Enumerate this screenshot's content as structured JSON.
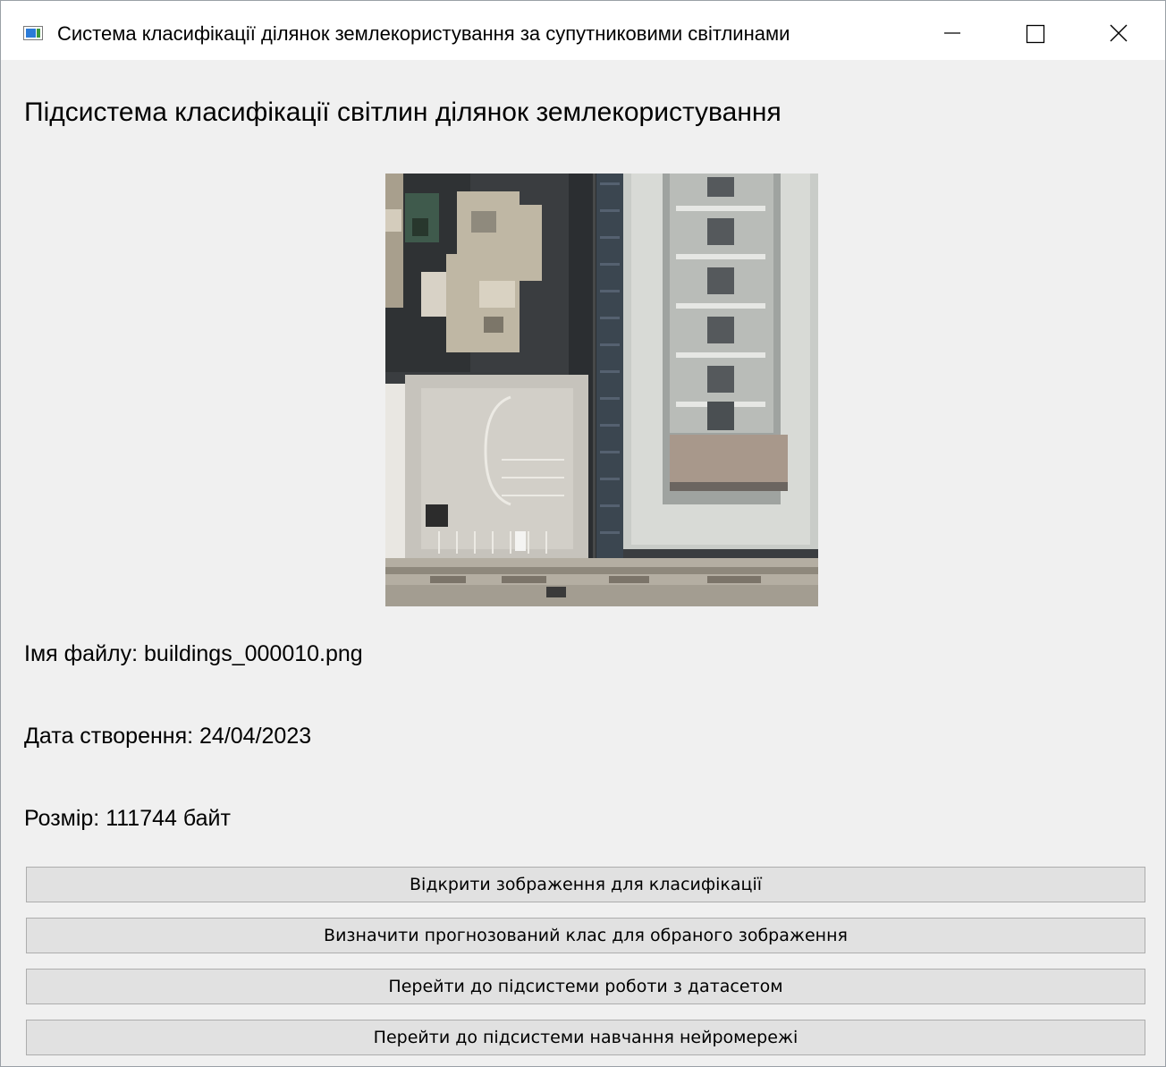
{
  "window": {
    "title": "Система класифікації ділянок землекористування за супутниковими світлинами",
    "controls": [
      "minimize-icon",
      "maximize-icon",
      "close-icon"
    ]
  },
  "main": {
    "heading": "Підсистема класифікації світлин ділянок землекористування",
    "image_alt": "buildings_000010.png",
    "file_name": "Імя файлу: buildings_000010.png",
    "created_date": "Дата створення: 24/04/2023",
    "file_size": "Розмір: 111744 байт"
  },
  "buttons": {
    "open_image": "Відкрити зображення для класифікації",
    "predict_class": "Визначити прогнозований клас для обраного зображення",
    "goto_dataset": "Перейти до підсистеми роботи з датасетом",
    "goto_training": "Перейти до підсистеми навчання нейромережі"
  },
  "colors": {
    "window_bg": "#f0f0f0",
    "titlebar_bg": "#ffffff",
    "button_bg": "#e1e1e1",
    "button_border": "#adadad"
  }
}
